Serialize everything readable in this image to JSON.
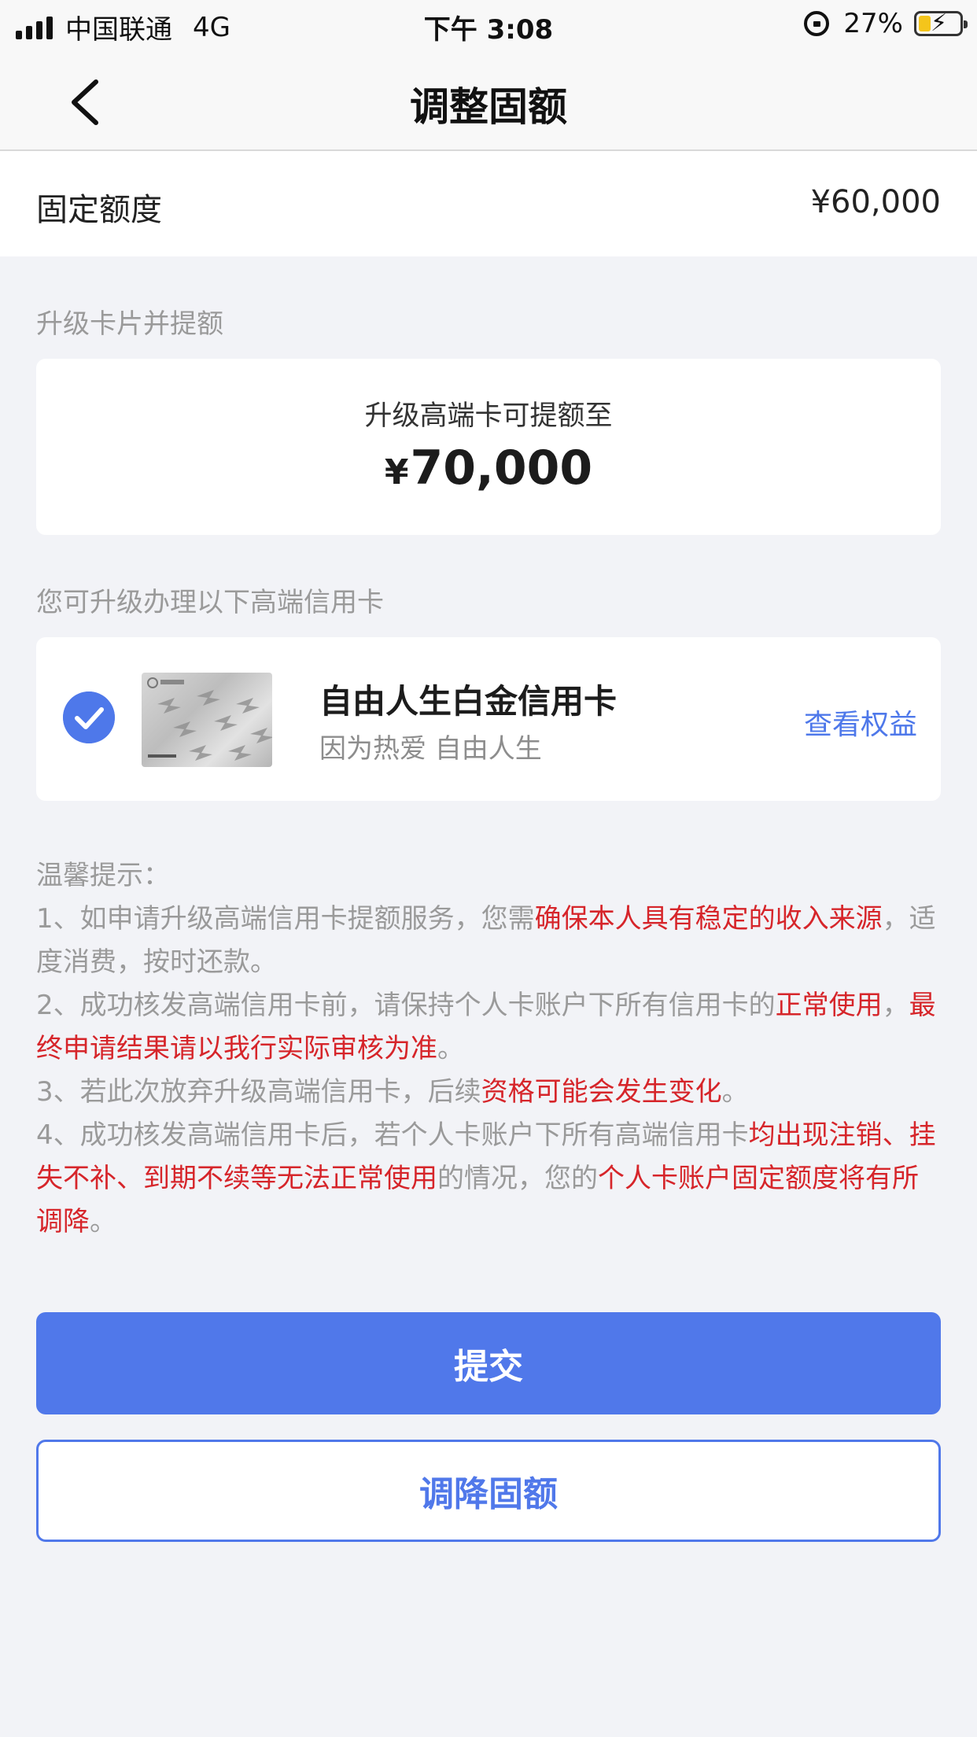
{
  "status_bar": {
    "carrier": "中国联通",
    "network": "4G",
    "time": "下午 3:08",
    "battery": "27%",
    "battery_level": 0.27,
    "battery_color": "#f4c51b"
  },
  "nav": {
    "title": "调整固额",
    "back_icon": "chevron-left-icon"
  },
  "fixed_limit": {
    "label": "固定额度",
    "value": "¥60,000"
  },
  "upgrade_section": {
    "label": "升级卡片并提额",
    "card_text": "升级高端卡可提额至",
    "amount_currency": "¥",
    "amount": "70,000"
  },
  "cards_section": {
    "label": "您可升级办理以下高端信用卡",
    "cards": [
      {
        "name": "自由人生白金信用卡",
        "slogan": "因为热爱 自由人生",
        "link": "查看权益",
        "selected": true
      }
    ]
  },
  "tips": {
    "title": "温馨提示：",
    "items": [
      [
        {
          "text": "1、如申请升级高端信用卡提额服务，您需",
          "red": false
        },
        {
          "text": "确保本人具有稳定的收入来源",
          "red": true
        },
        {
          "text": "，适度消费，按时还款。",
          "red": false
        }
      ],
      [
        {
          "text": "2、成功核发高端信用卡前，请保持个人卡账户下所有信用卡的",
          "red": false
        },
        {
          "text": "正常使用",
          "red": true
        },
        {
          "text": "，",
          "red": false
        },
        {
          "text": "最终申请结果请以我行实际审核为准",
          "red": true
        },
        {
          "text": "。",
          "red": false
        }
      ],
      [
        {
          "text": "3、若此次放弃升级高端信用卡，后续",
          "red": false
        },
        {
          "text": "资格可能会发生变化",
          "red": true
        },
        {
          "text": "。",
          "red": false
        }
      ],
      [
        {
          "text": "4、成功核发高端信用卡后，若个人卡账户下所有高端信用卡",
          "red": false
        },
        {
          "text": "均出现注销、挂失不补、到期不续等无法正常使用",
          "red": true
        },
        {
          "text": "的情况，您的",
          "red": false
        },
        {
          "text": "个人卡账户固定额度将有所调降",
          "red": true
        },
        {
          "text": "。",
          "red": false
        }
      ]
    ]
  },
  "buttons": {
    "submit": "提交",
    "lower": "调降固额"
  },
  "colors": {
    "accent": "#5078ea",
    "warning": "#d6252a",
    "muted": "#9a9a9a",
    "background": "#f2f3f7"
  }
}
